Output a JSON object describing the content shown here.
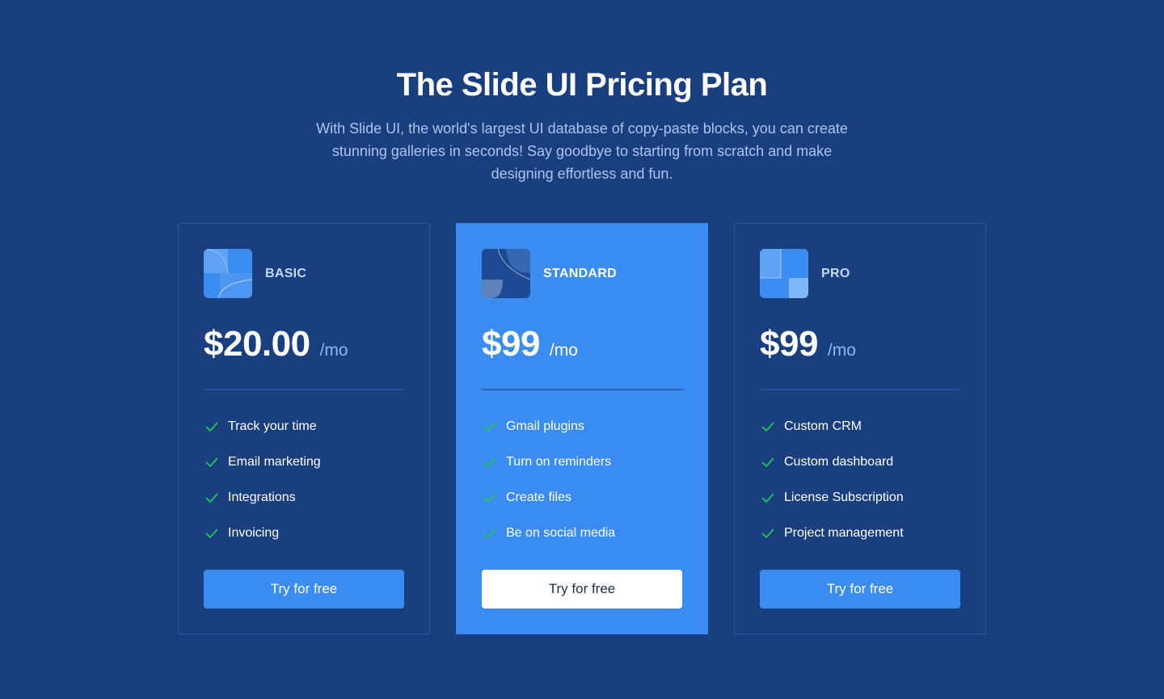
{
  "header": {
    "title": "The Slide UI Pricing Plan",
    "subtitle": "With Slide UI, the world's largest UI database of copy-paste blocks, you can create stunning galleries in seconds! Say goodbye to starting from scratch and make designing effortless and fun."
  },
  "colors": {
    "page_background": "#1a3f7f",
    "featured_card": "#3b8cf0",
    "button_primary": "#3b8cf0",
    "check": "#22c55e"
  },
  "plans": [
    {
      "name": "BASIC",
      "icon": "basic-plan-icon",
      "price": "$20.00",
      "period": "/mo",
      "features": [
        "Track your time",
        "Email marketing",
        "Integrations",
        "Invoicing"
      ],
      "cta": "Try for free"
    },
    {
      "name": "STANDARD",
      "icon": "standard-plan-icon",
      "price": "$99",
      "period": "/mo",
      "features": [
        "Gmail plugins",
        "Turn on reminders",
        "Create files",
        "Be on social media"
      ],
      "cta": "Try for free",
      "featured": true
    },
    {
      "name": "PRO",
      "icon": "pro-plan-icon",
      "price": "$99",
      "period": "/mo",
      "features": [
        "Custom CRM",
        "Custom dashboard",
        "License Subscription",
        "Project management"
      ],
      "cta": "Try for free"
    }
  ]
}
